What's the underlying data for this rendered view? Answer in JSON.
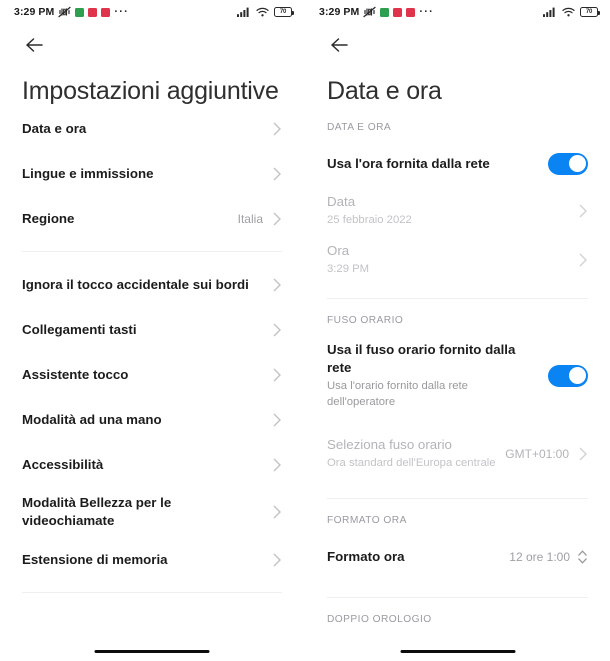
{
  "status_bar": {
    "time": "3:29 PM",
    "icons": [
      "vibrate-off-icon",
      "app-icon-green",
      "app-icon-red",
      "app-icon-red-2",
      "overflow-dots-icon"
    ],
    "app_icon_colors": [
      "#2e9e4f",
      "#e0344c",
      "#e0344c"
    ],
    "signal": "signal-bars-icon",
    "wifi": "wifi-icon",
    "battery_level": "70"
  },
  "left_screen": {
    "back": "back-arrow",
    "title": "Impostazioni aggiuntive",
    "group_1": [
      {
        "title": "Data e ora",
        "value": "",
        "chevron": true
      },
      {
        "title": "Lingue e immissione",
        "value": "",
        "chevron": true
      },
      {
        "title": "Regione",
        "value": "Italia",
        "chevron": true
      }
    ],
    "group_2": [
      {
        "title": "Ignora il tocco accidentale sui bordi",
        "value": "",
        "chevron": true
      },
      {
        "title": "Collegamenti tasti",
        "value": "",
        "chevron": true
      },
      {
        "title": "Assistente tocco",
        "value": "",
        "chevron": true
      },
      {
        "title": "Modalità ad una mano",
        "value": "",
        "chevron": true
      },
      {
        "title": "Accessibilità",
        "value": "",
        "chevron": true
      },
      {
        "title": "Modalità Bellezza per le videochiamate",
        "value": "",
        "chevron": true
      },
      {
        "title": "Estensione di memoria",
        "value": "",
        "chevron": true
      }
    ]
  },
  "right_screen": {
    "back": "back-arrow",
    "title": "Data e ora",
    "section_date_time": {
      "header": "DATA E ORA",
      "network_time": {
        "title": "Usa l'ora fornita dalla rete",
        "toggle_on": true
      },
      "date": {
        "title": "Data",
        "sub": "25 febbraio 2022"
      },
      "time": {
        "title": "Ora",
        "sub": "3:29 PM"
      }
    },
    "section_timezone": {
      "header": "FUSO ORARIO",
      "network_timezone": {
        "title": "Usa il fuso orario fornito dalla rete",
        "sub": "Usa l'orario fornito dalla rete dell'operatore",
        "toggle_on": true
      },
      "select_timezone": {
        "title": "Seleziona fuso orario",
        "sub": "Ora standard dell'Europa centrale",
        "value": "GMT+01:00"
      }
    },
    "section_time_format": {
      "header": "FORMATO ORA",
      "time_format": {
        "title": "Formato ora",
        "value": "12 ore 1:00"
      }
    },
    "section_dual_clock": {
      "header": "DOPPIO OROLOGIO"
    }
  },
  "theme": {
    "accent": "#0b84f3",
    "text": "#1c1c1c",
    "muted": "#9a9a9e",
    "divider": "#efeff1"
  }
}
